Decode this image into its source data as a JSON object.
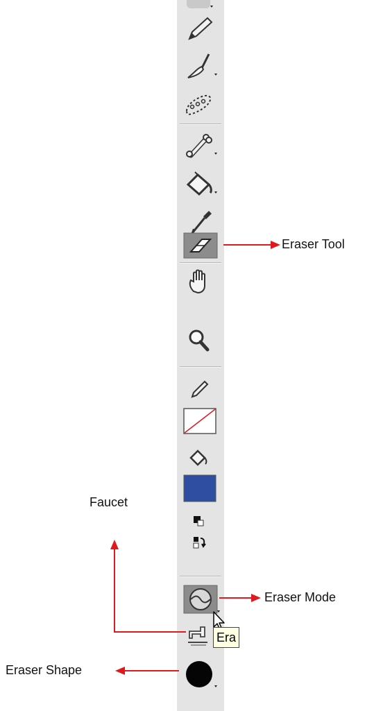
{
  "colors": {
    "toolbar_bg": "#e4e4e4",
    "fill_swatch": "#2e4ea1",
    "annotation_arrow": "#e0191f",
    "tooltip_bg": "#ffffe1"
  },
  "tools": [
    {
      "icon": "pencil-icon"
    },
    {
      "icon": "brush-icon"
    },
    {
      "icon": "deco-spray-icon"
    },
    {
      "icon": "bone-tool-icon"
    },
    {
      "icon": "paint-bucket-icon"
    },
    {
      "icon": "eyedropper-icon"
    },
    {
      "icon": "eraser-icon",
      "selected": true
    },
    {
      "icon": "hand-icon"
    },
    {
      "icon": "zoom-icon"
    },
    {
      "icon": "stroke-color-icon"
    },
    {
      "icon": "no-color-swatch"
    },
    {
      "icon": "fill-color-icon"
    },
    {
      "icon": "fill-swatch"
    },
    {
      "icon": "black-white-icon"
    },
    {
      "icon": "swap-colors-icon"
    },
    {
      "icon": "eraser-mode-icon"
    },
    {
      "icon": "faucet-icon"
    },
    {
      "icon": "eraser-shape-icon"
    }
  ],
  "tooltip": {
    "text": "Era"
  },
  "annotations": {
    "eraser_tool": "Eraser Tool",
    "eraser_mode": "Eraser Mode",
    "faucet": "Faucet",
    "eraser_shape": "Eraser Shape"
  }
}
